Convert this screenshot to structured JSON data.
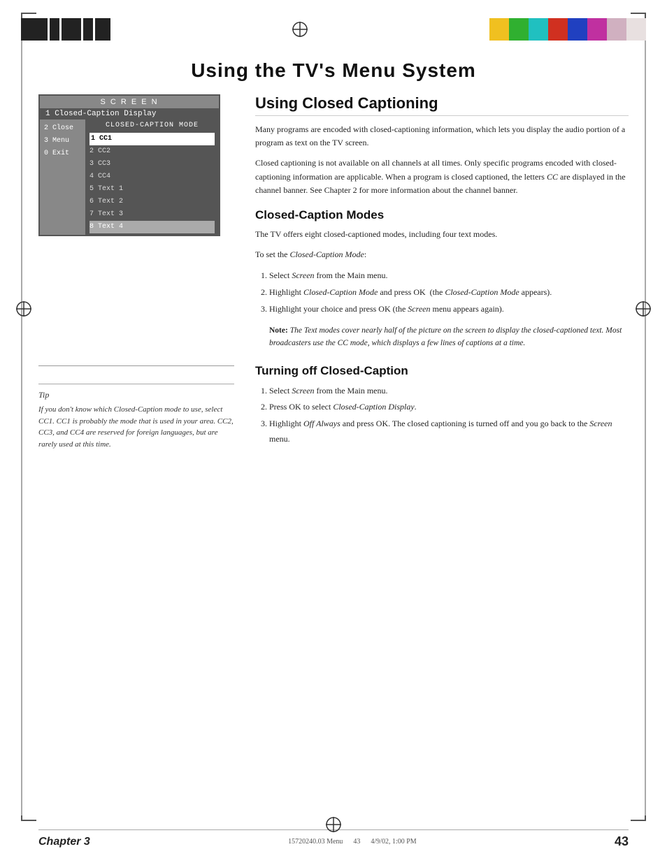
{
  "page": {
    "title": "Using the TV's Menu System",
    "background": "#ffffff"
  },
  "top_bar": {
    "left_black_strips": [
      "bs1",
      "bs2",
      "bs3",
      "bs4",
      "bs5",
      "bs6"
    ],
    "right_color_strips": [
      "yellow",
      "green",
      "cyan",
      "red",
      "blue",
      "magenta",
      "ltgray",
      "white"
    ]
  },
  "tv_menu": {
    "screen_title": "S C R E E N",
    "item1": "1 Closed-Caption Display",
    "left_items": [
      "2 Close",
      "3 Menu",
      "0 Exit"
    ],
    "submenu_title": "CLOSED-CAPTION MODE",
    "submenu_items": [
      {
        "label": "1 CC1",
        "state": "selected"
      },
      {
        "label": "2 CC2",
        "state": "normal"
      },
      {
        "label": "3 CC3",
        "state": "normal"
      },
      {
        "label": "4 CC4",
        "state": "normal"
      },
      {
        "label": "5 Text 1",
        "state": "normal"
      },
      {
        "label": "6 Text 2",
        "state": "normal"
      },
      {
        "label": "7 Text 3",
        "state": "normal"
      },
      {
        "label": "8 Text 4",
        "state": "highlighted"
      }
    ]
  },
  "tip": {
    "label": "Tip",
    "text": "If you don't know which Closed-Caption mode to use, select CC1. CC1 is probably the mode that is used in your area. CC2, CC3, and CC4 are reserved for foreign languages, but are rarely used at this time."
  },
  "main_section": {
    "title": "Using Closed Captioning",
    "paragraphs": [
      "Many programs are encoded with closed-captioning information, which lets you display the audio portion of a program as text on the TV screen.",
      "Closed captioning is not available on all channels at all times. Only specific programs encoded with closed-captioning information are applicable. When a program is closed captioned, the letters CC are displayed in the channel banner. See Chapter 2 for more information about the channel banner."
    ]
  },
  "modes_section": {
    "title": "Closed-Caption Modes",
    "intro": "The TV offers eight closed-captioned modes, including four text modes.",
    "to_set": "To set the Closed-Caption Mode:",
    "steps": [
      "Select Screen from the Main menu.",
      "Highlight Closed-Caption Mode and press OK (the Closed-Caption Mode appears).",
      "Highlight your choice and press OK (the Screen menu appears again)."
    ],
    "note": {
      "label": "Note:",
      "text": " The Text modes cover nearly half of the picture on the screen to display the closed-captioned text. Most broadcasters use the CC mode, which displays a few lines of captions at a time."
    }
  },
  "turning_off_section": {
    "title": "Turning off Closed-Caption",
    "steps": [
      "Select Screen from the Main menu.",
      "Press OK to select Closed-Caption Display.",
      "Highlight Off Always and press OK. The closed captioning is turned off and you go back to the Screen menu."
    ]
  },
  "footer": {
    "chapter_label": "Chapter 3",
    "page_number": "43",
    "center_left": "15720240.03 Menu",
    "center_mid": "43",
    "center_right": "4/9/02, 1:00 PM"
  }
}
